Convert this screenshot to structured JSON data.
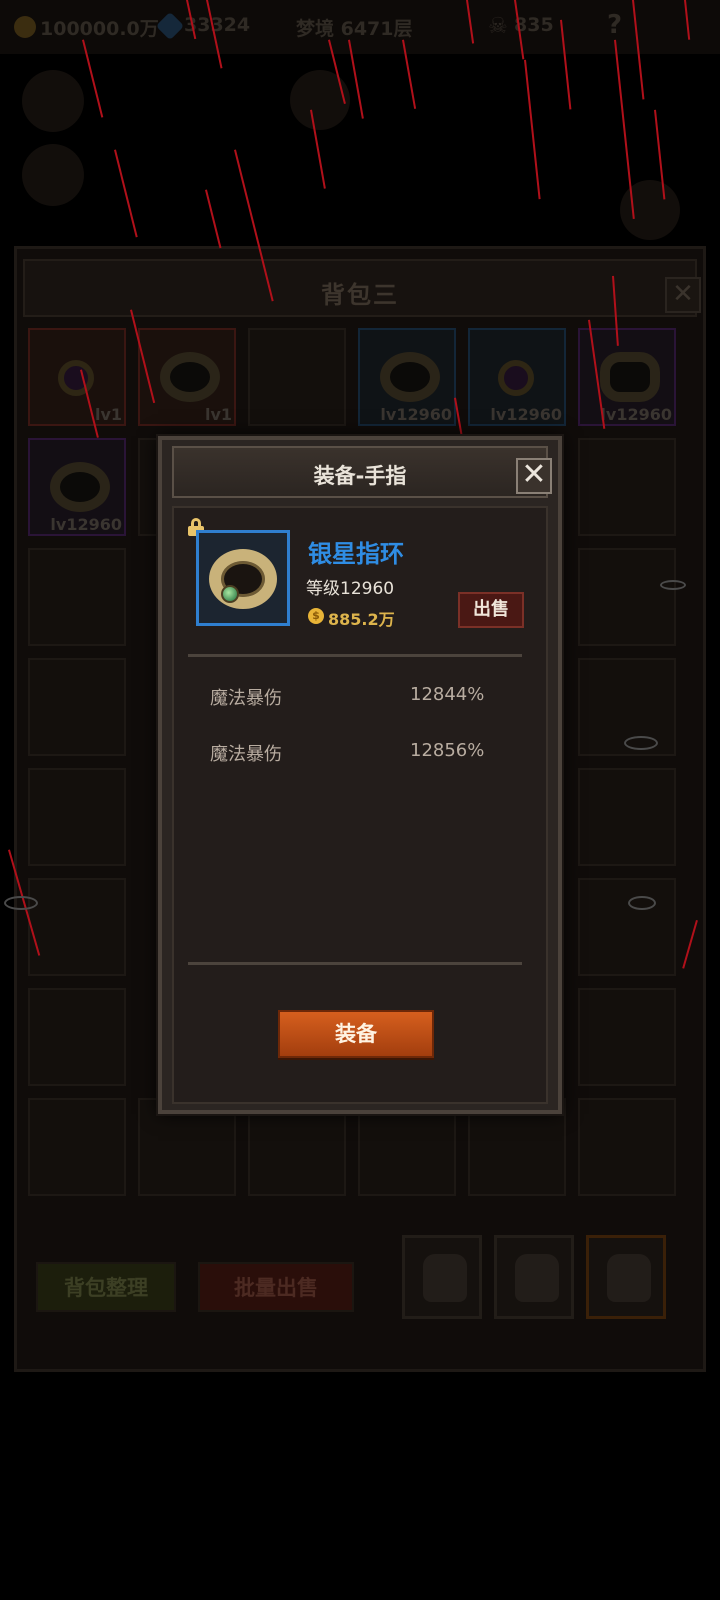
{
  "topbar": {
    "gold": "100000.0万",
    "gems": "33324",
    "stage": "梦境 6471层",
    "kills": "835",
    "help_glyph": "?"
  },
  "backpack": {
    "title": "背包三",
    "close_glyph": "✕",
    "items": [
      {
        "level": "lv1",
        "quality": "red",
        "icon": "amulet-icon"
      },
      {
        "level": "lv1",
        "quality": "red",
        "icon": "ring-icon"
      },
      {
        "level": "",
        "quality": "empty",
        "icon": ""
      },
      {
        "level": "lv12960",
        "quality": "blue",
        "icon": "ring-icon"
      },
      {
        "level": "lv12960",
        "quality": "blue",
        "icon": "amulet-icon"
      },
      {
        "level": "lv12960",
        "quality": "purple",
        "icon": "armor-icon"
      },
      {
        "level": "lv12960",
        "quality": "purple",
        "icon": "ring-icon"
      }
    ],
    "sort_button": "背包整理",
    "bulk_sell_button": "批量出售"
  },
  "dialog": {
    "title": "装备-手指",
    "close_glyph": "✕",
    "item_name": "银星指环",
    "item_level": "等级12960",
    "price": "885.2万",
    "coin_glyph": "$",
    "sell_button": "出售",
    "stats": [
      {
        "name": "魔法暴伤",
        "value": "12844%"
      },
      {
        "name": "魔法暴伤",
        "value": "12856%"
      }
    ],
    "equip_button": "装备"
  },
  "colors": {
    "item_name": "#2f8de4",
    "equip_button": "#c4501a",
    "sell_button": "#4a1814",
    "rain": "#b0101a"
  }
}
